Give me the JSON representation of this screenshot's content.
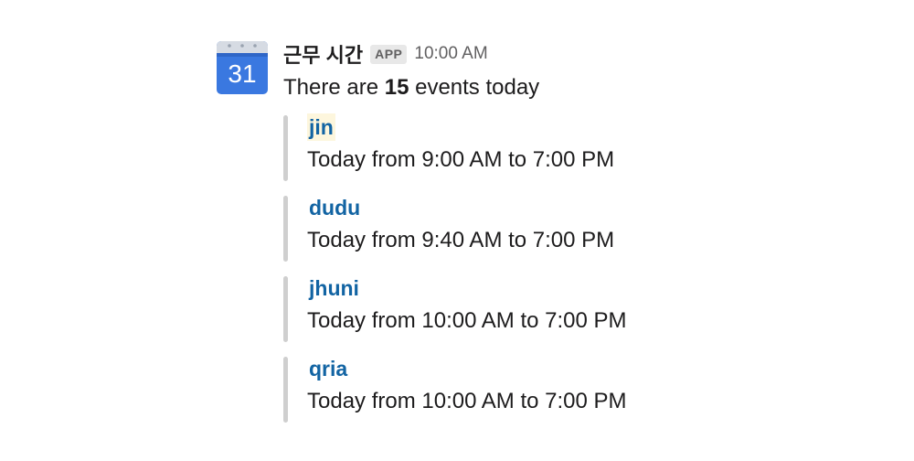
{
  "message": {
    "avatar": {
      "icon": "google-calendar-icon",
      "day_number": "31",
      "accent_color": "#3a78e0"
    },
    "sender_name": "근무 시간",
    "app_badge": "APP",
    "timestamp": "10:00 AM",
    "summary": {
      "prefix": "There are ",
      "count": "15",
      "suffix": " events today"
    },
    "events": [
      {
        "name": "jin",
        "detail": "Today from 9:00 AM to 7:00 PM",
        "highlighted": true
      },
      {
        "name": "dudu",
        "detail": "Today from 9:40 AM to 7:00 PM",
        "highlighted": false
      },
      {
        "name": "jhuni",
        "detail": "Today from 10:00 AM to 7:00 PM",
        "highlighted": false
      },
      {
        "name": "qria",
        "detail": "Today from 10:00 AM to 7:00 PM",
        "highlighted": false
      }
    ]
  },
  "colors": {
    "link": "#1264a3",
    "attachment_bar": "#cfcfcf",
    "muted_text": "#616061"
  }
}
